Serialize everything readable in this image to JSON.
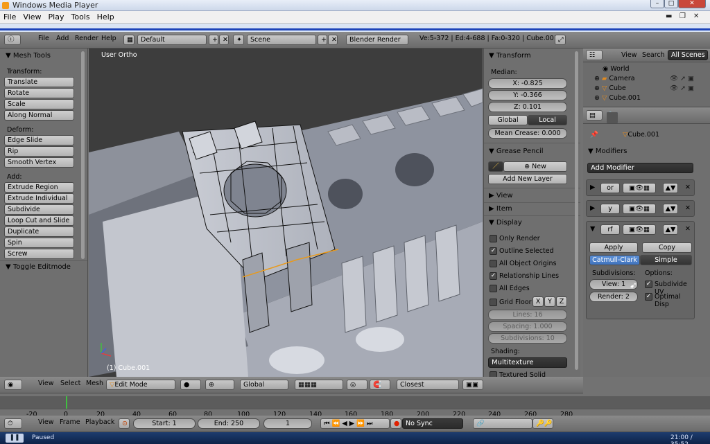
{
  "wmp": {
    "title": "Windows Media Player",
    "menu": [
      "File",
      "View",
      "Play",
      "Tools",
      "Help"
    ],
    "status": "Paused",
    "time": "21:00 / 35:52"
  },
  "info": {
    "menu": [
      "File",
      "Add",
      "Render",
      "Help"
    ],
    "layout": "Default",
    "scene": "Scene",
    "engine": "Blender Render",
    "stats": "Ve:5-372 | Ed:4-688 | Fa:0-320 | Cube.001"
  },
  "tools": {
    "title": "Mesh Tools",
    "transform_label": "Transform:",
    "transform": [
      "Translate",
      "Rotate",
      "Scale",
      "Along Normal"
    ],
    "deform_label": "Deform:",
    "deform": [
      "Edge Slide",
      "Rip",
      "Smooth Vertex"
    ],
    "add_label": "Add:",
    "add": [
      "Extrude Region",
      "Extrude Individual",
      "Subdivide",
      "Loop Cut and Slide",
      "Duplicate",
      "Spin",
      "Screw"
    ],
    "toggle": "Toggle Editmode"
  },
  "viewport": {
    "label": "User Ortho",
    "object": "(1) Cube.001"
  },
  "props": {
    "transform_title": "Transform",
    "median": "Median:",
    "x": "X: -0.825",
    "y": "Y: -0.366",
    "z": "Z: 0.101",
    "global": "Global",
    "local": "Local",
    "crease": "Mean Crease: 0.000",
    "grease": "Grease Pencil",
    "new": "New",
    "add_layer": "Add New Layer",
    "view": "View",
    "item": "Item",
    "display": "Display",
    "only_render": "Only Render",
    "outline": "Outline Selected",
    "all_origins": "All Object Origins",
    "rel_lines": "Relationship Lines",
    "all_edges": "All Edges",
    "grid_floor": "Grid Floor",
    "gx": "X",
    "gy": "Y",
    "gz": "Z",
    "lines": "Lines: 16",
    "spacing": "Spacing: 1.000",
    "subdivisions": "Subdivisions: 10",
    "shading": "Shading:",
    "shading_mode": "Multitexture",
    "textured_solid": "Textured Solid"
  },
  "outliner": {
    "view": "View",
    "search": "Search",
    "scenes": "All Scenes",
    "items": [
      "World",
      "Camera",
      "Cube",
      "Cube.001"
    ]
  },
  "modifiers": {
    "object": "Cube.001",
    "title": "Modifiers",
    "add": "Add Modifier",
    "m1": "or",
    "m2": "y",
    "m3": "rf",
    "apply": "Apply",
    "copy": "Copy",
    "catmull": "Catmull-Clark",
    "simple": "Simple",
    "subdiv_label": "Subdivisions:",
    "options_label": "Options:",
    "view_val": "View: 1",
    "render_val": "Render: 2",
    "subdiv_uv": "Subdivide UV",
    "optimal": "Optimal Disp"
  },
  "v3dheader": {
    "view": "View",
    "select": "Select",
    "mesh": "Mesh",
    "mode": "Edit Mode",
    "orientation": "Global",
    "snap": "Closest"
  },
  "timeline": {
    "ticks": [
      "-20",
      "0",
      "20",
      "40",
      "60",
      "80",
      "100",
      "120",
      "140",
      "160",
      "180",
      "200",
      "220",
      "240",
      "260",
      "280"
    ],
    "view": "View",
    "frame": "Frame",
    "playback": "Playback",
    "start": "Start: 1",
    "end": "End: 250",
    "current": "1",
    "sync": "No Sync"
  }
}
